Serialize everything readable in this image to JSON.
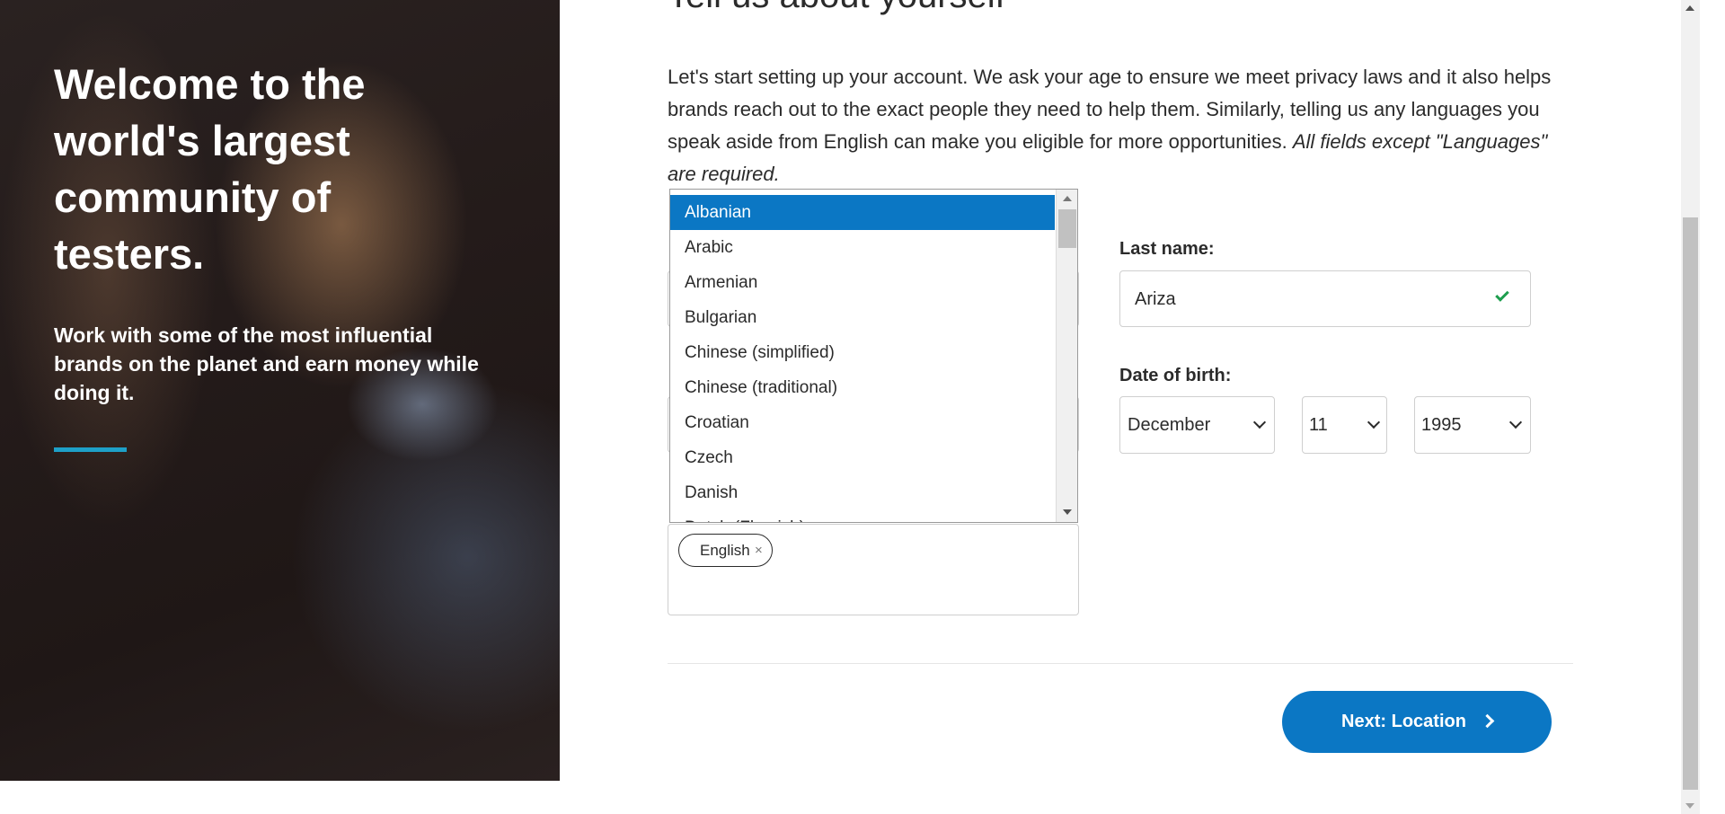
{
  "hero": {
    "title": "Welcome to the world's largest community of testers.",
    "subtitle": "Work with some of the most influential brands on the planet and earn money while doing it."
  },
  "form": {
    "heading": "Tell us about yourself",
    "intro": "Let's start setting up your account. We ask your age to ensure we meet privacy laws and it also helps brands reach out to the exact people they need to help them. Similarly, telling us any languages you speak aside from English can make you eligible for more opportunities.",
    "intro_note": "All fields except \"Languages\" are required.",
    "last_name": {
      "label": "Last name:",
      "value": "Ariza"
    },
    "dob": {
      "label": "Date of birth:",
      "month": "December",
      "day": "11",
      "year": "1995"
    },
    "languages": {
      "chip": "English",
      "chip_remove": "×"
    },
    "next_label": "Next: Location"
  },
  "dropdown": {
    "options": [
      "Albanian",
      "Arabic",
      "Armenian",
      "Bulgarian",
      "Chinese (simplified)",
      "Chinese (traditional)",
      "Croatian",
      "Czech",
      "Danish",
      "Dutch (Flemish)"
    ],
    "selected": "Albanian"
  },
  "colors": {
    "primary": "#0b77c4",
    "accent_bar": "#1ea0c8",
    "valid": "#1e9e4e"
  }
}
